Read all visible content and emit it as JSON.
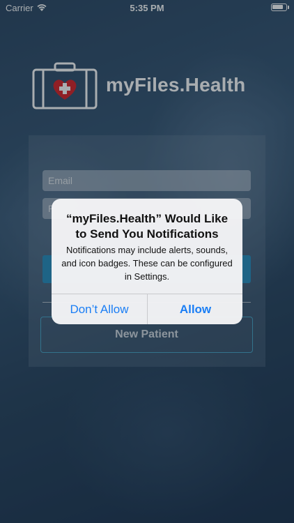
{
  "status_bar": {
    "carrier": "Carrier",
    "time": "5:35 PM",
    "battery_level": 0.85
  },
  "brand": {
    "name": "myFiles.Health",
    "logo_icon": "medical-briefcase-icon"
  },
  "login": {
    "email_placeholder": "Email",
    "password_placeholder": "P",
    "new_patient_label": "New Patient"
  },
  "alert": {
    "title": "“myFiles.Health” Would Like to Send You Notifications",
    "message": "Notifications may include alerts, sounds, and icon badges. These can be configured in Settings.",
    "deny_label": "Don’t Allow",
    "allow_label": "Allow"
  },
  "colors": {
    "accent": "#2a8fbf",
    "alert_button": "#1a7ef5",
    "heart": "#d9262a"
  }
}
